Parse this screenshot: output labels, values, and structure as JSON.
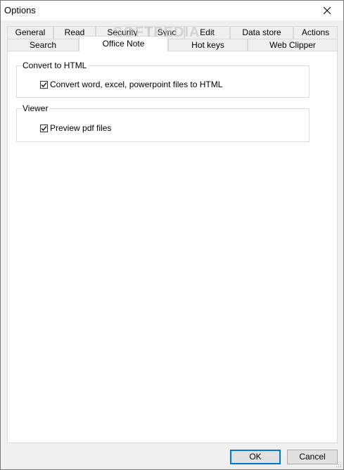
{
  "window": {
    "title": "Options",
    "watermark": "SOFTPEDIA"
  },
  "tabs": {
    "row_back": [
      {
        "label": "General"
      },
      {
        "label": "Read"
      },
      {
        "label": "Security"
      },
      {
        "label": "Sync"
      },
      {
        "label": "Edit"
      },
      {
        "label": "Data store"
      },
      {
        "label": "Actions"
      }
    ],
    "row_front": [
      {
        "label": "Search"
      },
      {
        "label": "Office Note",
        "active": true
      },
      {
        "label": "Hot keys"
      },
      {
        "label": "Web Clipper"
      }
    ]
  },
  "groups": {
    "convert": {
      "title": "Convert to HTML",
      "option_label": "Convert word, excel, powerpoint files to HTML",
      "checked": true
    },
    "viewer": {
      "title": "Viewer",
      "option_label": "Preview pdf files",
      "checked": true
    }
  },
  "buttons": {
    "ok": "OK",
    "cancel": "Cancel"
  }
}
